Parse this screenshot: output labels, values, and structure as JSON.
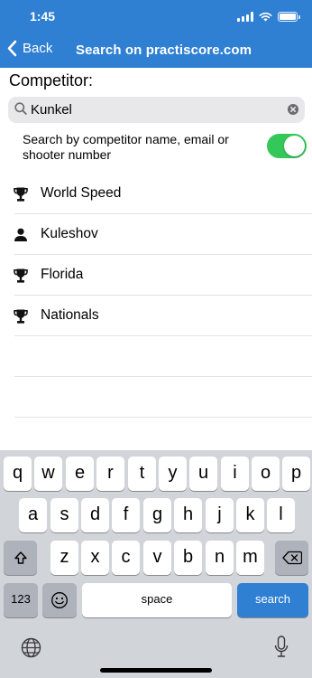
{
  "status_bar": {
    "time": "1:45"
  },
  "nav": {
    "back_label": "Back",
    "title": "Search on practiscore.com"
  },
  "competitor_label": "Competitor:",
  "search": {
    "value": "Kunkel",
    "placeholder": ""
  },
  "toggle": {
    "label": "Search by competitor name, email or shooter number",
    "on": true,
    "color": "#34c759"
  },
  "results": [
    {
      "label": "World Speed",
      "icon": "trophy-icon"
    },
    {
      "label": "Kuleshov",
      "icon": "person-icon"
    },
    {
      "label": "Florida",
      "icon": "trophy-icon"
    },
    {
      "label": "Nationals",
      "icon": "trophy-icon"
    }
  ],
  "keyboard": {
    "row1": [
      "q",
      "w",
      "e",
      "r",
      "t",
      "y",
      "u",
      "i",
      "o",
      "p"
    ],
    "row2": [
      "a",
      "s",
      "d",
      "f",
      "g",
      "h",
      "j",
      "k",
      "l"
    ],
    "row3": [
      "z",
      "x",
      "c",
      "v",
      "b",
      "n",
      "m"
    ],
    "numbers_label": "123",
    "space_label": "space",
    "search_label": "search",
    "shift_icon": "shift-icon",
    "delete_icon": "delete-icon",
    "emoji_icon": "emoji-icon",
    "globe_icon": "globe-icon",
    "mic_icon": "microphone-icon"
  },
  "colors": {
    "accent": "#2f7fd3",
    "toggle_on": "#34c759",
    "keyboard_bg": "#d1d4d9"
  }
}
